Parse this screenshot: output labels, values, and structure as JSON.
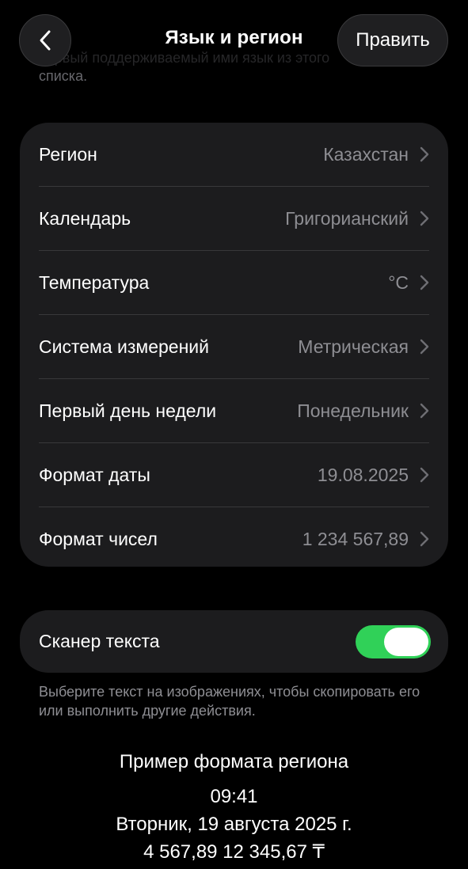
{
  "header": {
    "title": "Язык и регион",
    "edit_label": "Править",
    "partial_text_line1": "первый поддерживаемый ими язык из этого",
    "partial_text_line2": "списка."
  },
  "settings": [
    {
      "label": "Регион",
      "value": "Казахстан"
    },
    {
      "label": "Календарь",
      "value": "Григорианский"
    },
    {
      "label": "Температура",
      "value": "°C"
    },
    {
      "label": "Система измерений",
      "value": "Метрическая"
    },
    {
      "label": "Первый день недели",
      "value": "Понедельник"
    },
    {
      "label": "Формат даты",
      "value": "19.08.2025"
    },
    {
      "label": "Формат чисел",
      "value": "1 234 567,89"
    }
  ],
  "text_scanner": {
    "label": "Сканер текста",
    "enabled": true,
    "footnote": "Выберите текст на изображениях, чтобы скопировать его или выполнить другие действия."
  },
  "region_example": {
    "title": "Пример формата региона",
    "time": "09:41",
    "date": "Вторник, 19 августа 2025 г.",
    "numbers": "4 567,89 12 345,67 ₸"
  },
  "colors": {
    "background": "#000000",
    "card": "#1c1c1e",
    "secondary_text": "#8e8e93",
    "toggle_on": "#30d158"
  },
  "icons": {
    "back": "chevron-left-icon",
    "row_disclosure": "chevron-right-icon"
  }
}
